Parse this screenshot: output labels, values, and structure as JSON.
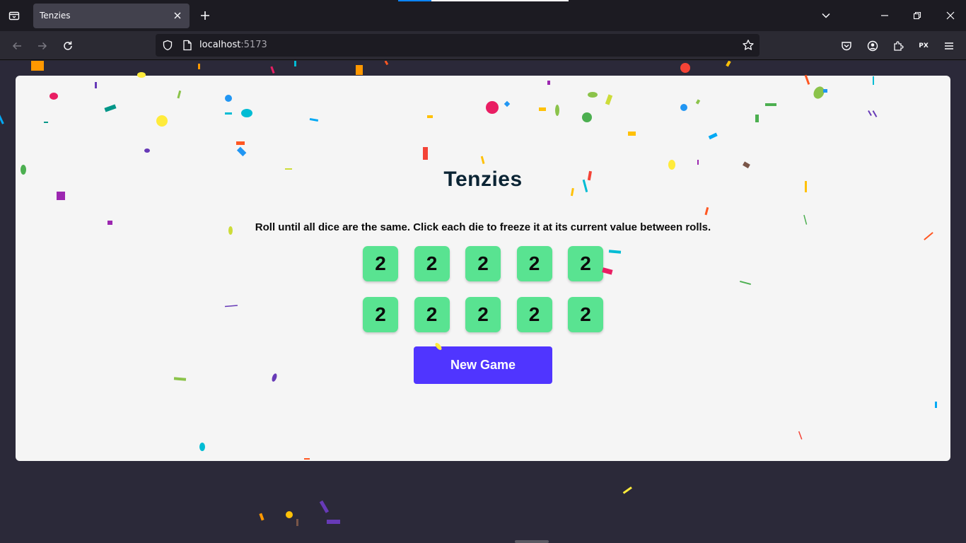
{
  "browser": {
    "tab_title": "Tenzies",
    "url_host": "localhost",
    "url_port": ":5173",
    "extension_badge": "PX"
  },
  "game": {
    "title": "Tenzies",
    "instructions": "Roll until all dice are the same. Click each die to freeze it at its current value between rolls.",
    "dice": [
      2,
      2,
      2,
      2,
      2,
      2,
      2,
      2,
      2,
      2
    ],
    "die_color": "#59e391",
    "new_game_label": "New Game",
    "button_color": "#5035ff"
  }
}
